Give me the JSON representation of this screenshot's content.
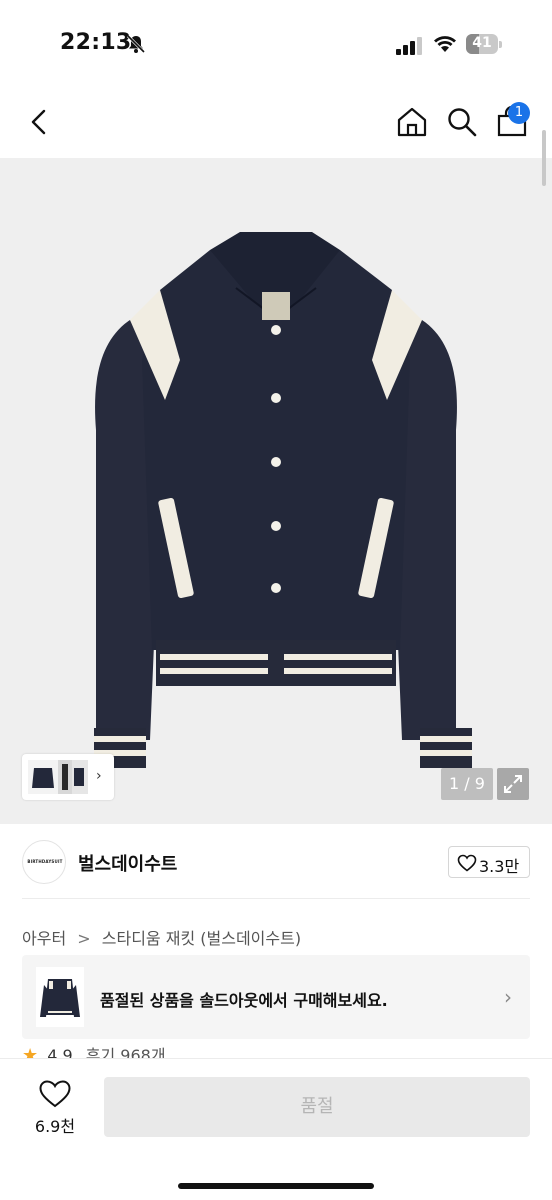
{
  "status_bar": {
    "time": "22:13",
    "battery_level": "41",
    "battery_fraction": 0.41
  },
  "nav": {
    "back_icon": "chevron-left-icon",
    "home_icon": "home-icon",
    "search_icon": "search-icon",
    "cart_icon": "shopping-bag-icon",
    "cart_badge": "1",
    "badge_color": "#1a73e8"
  },
  "gallery": {
    "page_indicator": "1 / 9",
    "thumb_arrow": "›",
    "expand_icon": "expand-icon"
  },
  "brand": {
    "logo_text": "BIRTHDAYSUIT",
    "name": "벌스데이수트",
    "like_count": "3.3만"
  },
  "breadcrumb": {
    "category": "아우터",
    "separator": ">",
    "product": "스타디움 재킷 (벌스데이수트)"
  },
  "soldout_banner": {
    "text": "품절된 상품을 솔드아웃에서 구매해보세요.",
    "chevron": "›"
  },
  "rating": {
    "star": "★",
    "score": "4.9",
    "review_text": "후기 968개"
  },
  "bottom_bar": {
    "wish_count": "6.9천",
    "soldout_label": "품절"
  }
}
